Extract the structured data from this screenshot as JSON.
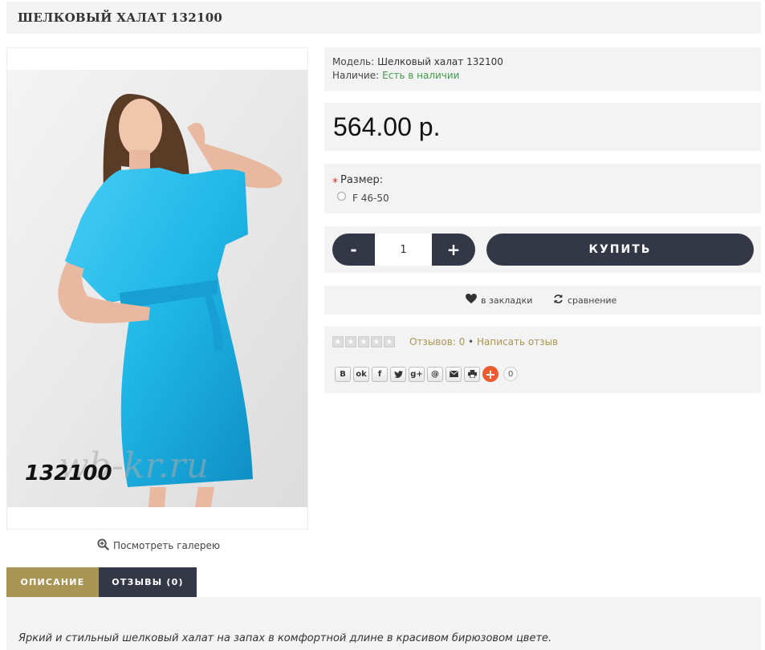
{
  "product": {
    "title": "ШЕЛКОВЫЙ ХАЛАТ 132100",
    "image_code": "132100",
    "image_watermark": "wb-kr.ru",
    "gallery_link": "Посмотреть галерею"
  },
  "info": {
    "model_label": "Модель:",
    "model_value": "Шелковый халат 132100",
    "availability_label": "Наличие:",
    "availability_value": "Есть в наличии"
  },
  "price": "564.00 р.",
  "option": {
    "required_mark": "*",
    "label": "Размер:",
    "value": "F 46-50"
  },
  "cart": {
    "minus_label": "-",
    "quantity": "1",
    "plus_label": "+",
    "buy_label": "КУПИТЬ"
  },
  "actions": {
    "wishlist_label": "в закладки",
    "compare_label": "сравнение"
  },
  "reviews": {
    "rating": 0,
    "max_rating": 5,
    "reviews_count_label": "Отзывов: 0",
    "separator": "•",
    "write_review_label": "Написать отзыв"
  },
  "share": {
    "icons": [
      "vk-icon",
      "odnoklassniki-icon",
      "facebook-icon",
      "twitter-icon",
      "google-plus-icon",
      "mail-icon",
      "email-icon",
      "print-icon",
      "add-icon"
    ],
    "count": "0"
  },
  "tabs": {
    "description_label": "ОПИСАНИЕ",
    "reviews_label": "ОТЗЫВЫ (0)"
  },
  "description": "Яркий и стильный шелковый халат на запах в комфортной длине в красивом бирюзовом цвете.",
  "colors": {
    "accent_gold": "#a99556",
    "dark_button": "#343746",
    "available_green": "#3f9b4a",
    "panel_bg": "#f3f3f3",
    "robe_turquoise": "#1fb6e6"
  }
}
